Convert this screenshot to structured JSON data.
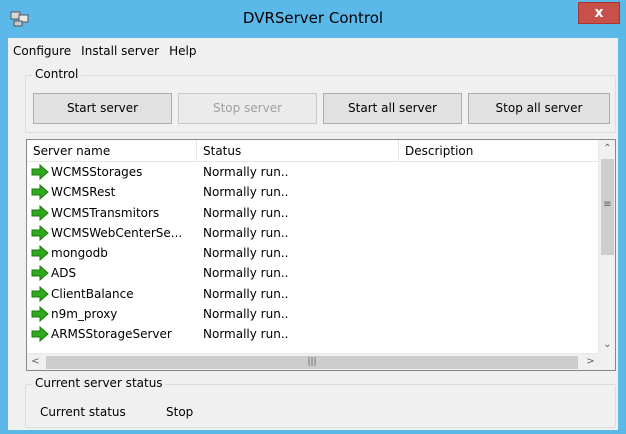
{
  "window": {
    "title": "DVRServer Control",
    "close_label": "x"
  },
  "menu": [
    "Configure",
    "Install server",
    "Help"
  ],
  "control": {
    "label": "Control",
    "buttons": {
      "start": "Start server",
      "stop": "Stop server",
      "start_all": "Start all server",
      "stop_all": "Stop all server"
    }
  },
  "servers": {
    "columns": [
      "Server name",
      "Status",
      "Description"
    ],
    "rows": [
      {
        "name": "WCMSStorages",
        "status": "Normally run..",
        "description": ""
      },
      {
        "name": "WCMSRest",
        "status": "Normally run..",
        "description": ""
      },
      {
        "name": "WCMSTransmitors",
        "status": "Normally run..",
        "description": ""
      },
      {
        "name": "WCMSWebCenterSe...",
        "status": "Normally run..",
        "description": ""
      },
      {
        "name": "mongodb",
        "status": "Normally run..",
        "description": ""
      },
      {
        "name": "ADS",
        "status": "Normally run..",
        "description": ""
      },
      {
        "name": "ClientBalance",
        "status": "Normally run..",
        "description": ""
      },
      {
        "name": "n9m_proxy",
        "status": "Normally run..",
        "description": ""
      },
      {
        "name": "ARMSStorageServer",
        "status": "Normally run..",
        "description": ""
      }
    ],
    "row_icon": "green-arrow-icon"
  },
  "status_panel": {
    "label": "Current server status",
    "status_label": "Current status",
    "status_value": "Stop"
  },
  "colors": {
    "titlebar": "#5cb8e8",
    "close": "#c7504a",
    "arrow": "#2fa81e"
  }
}
